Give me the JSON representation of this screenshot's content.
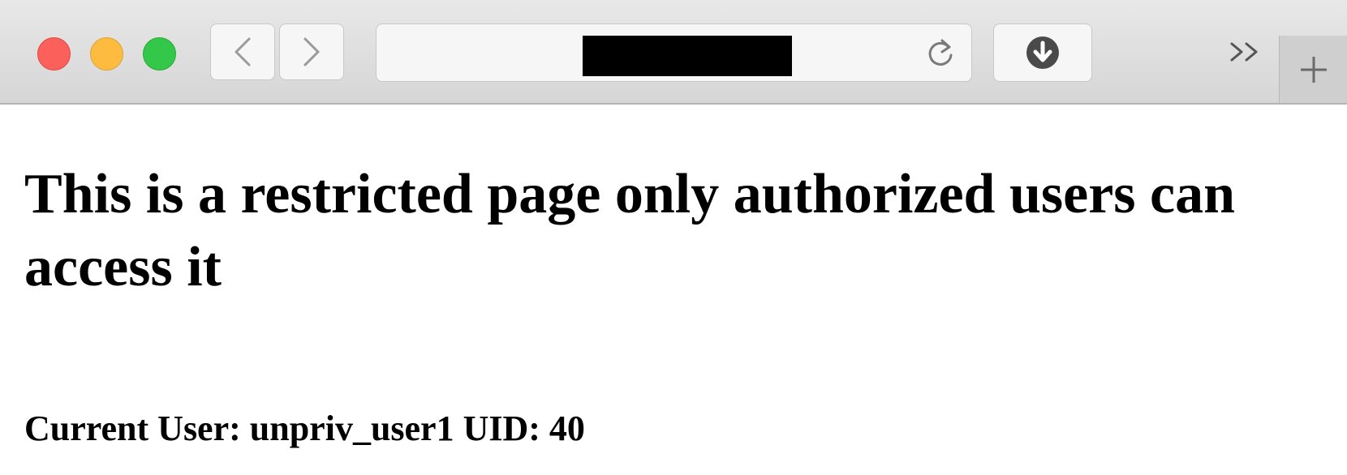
{
  "browser": {
    "controls": {
      "close": {
        "icon": "close-dot",
        "color": "#fc605b"
      },
      "minimize": {
        "icon": "minimize-dot",
        "color": "#fdbc40"
      },
      "zoom": {
        "icon": "zoom-dot",
        "color": "#34c84a"
      }
    },
    "nav": {
      "back_icon": "chevron-left-icon",
      "forward_icon": "chevron-right-icon"
    },
    "address_bar": {
      "url_redacted": true,
      "reload_icon": "reload-icon"
    },
    "toolbar": {
      "download_icon": "download-icon",
      "overflow_icon": "double-chevron-right-icon",
      "new_tab_icon": "plus-icon"
    }
  },
  "page": {
    "heading": "This is a restricted page only authorized users can access it",
    "current_user": "Current User: unpriv_user1 UID: 40"
  }
}
